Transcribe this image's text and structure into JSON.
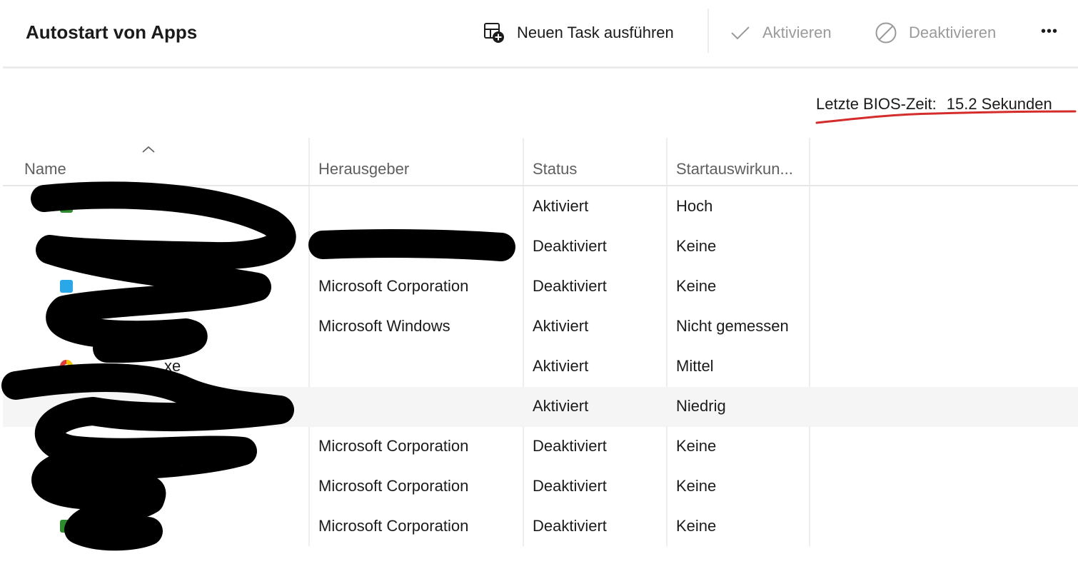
{
  "header": {
    "title": "Autostart von Apps",
    "commands": {
      "new_task": "Neuen Task ausführen",
      "activate": "Aktivieren",
      "deactivate": "Deaktivieren",
      "more": "•••"
    }
  },
  "bios": {
    "label": "Letzte BIOS-Zeit:",
    "value": "15.2 Sekunden"
  },
  "table": {
    "columns": {
      "name": "Name",
      "publisher": "Herausgeber",
      "status": "Status",
      "impact": "Startauswirkun..."
    },
    "rows": [
      {
        "name": "",
        "publisher": "",
        "status": "Aktiviert",
        "impact": "Hoch",
        "icon": "green-app-icon"
      },
      {
        "name": "",
        "publisher": "",
        "status": "Deaktiviert",
        "impact": "Keine",
        "icon": ""
      },
      {
        "name": "",
        "publisher": "Microsoft Corporation",
        "status": "Deaktiviert",
        "impact": "Keine",
        "icon": "blue-app-icon"
      },
      {
        "name": "",
        "publisher": "Microsoft Windows",
        "status": "Aktiviert",
        "impact": "Nicht gemessen",
        "icon": ""
      },
      {
        "name": "xe",
        "publisher": "",
        "status": "Aktiviert",
        "impact": "Mittel",
        "icon": "color-wheel-icon"
      },
      {
        "name": "",
        "publisher": "",
        "status": "Aktiviert",
        "impact": "Niedrig",
        "icon": ""
      },
      {
        "name": "",
        "publisher": "Microsoft Corporation",
        "status": "Deaktiviert",
        "impact": "Keine",
        "icon": ""
      },
      {
        "name": "",
        "publisher": "Microsoft Corporation",
        "status": "Deaktiviert",
        "impact": "Keine",
        "icon": ""
      },
      {
        "name": "",
        "publisher": "Microsoft Corporation",
        "status": "Deaktiviert",
        "impact": "Keine",
        "icon": "green-app-icon"
      }
    ]
  },
  "colors": {
    "underline": "#d42b2b",
    "redaction": "#000000",
    "disabled_text": "#9a9a9a",
    "selected_row": "#f5f5f5"
  }
}
